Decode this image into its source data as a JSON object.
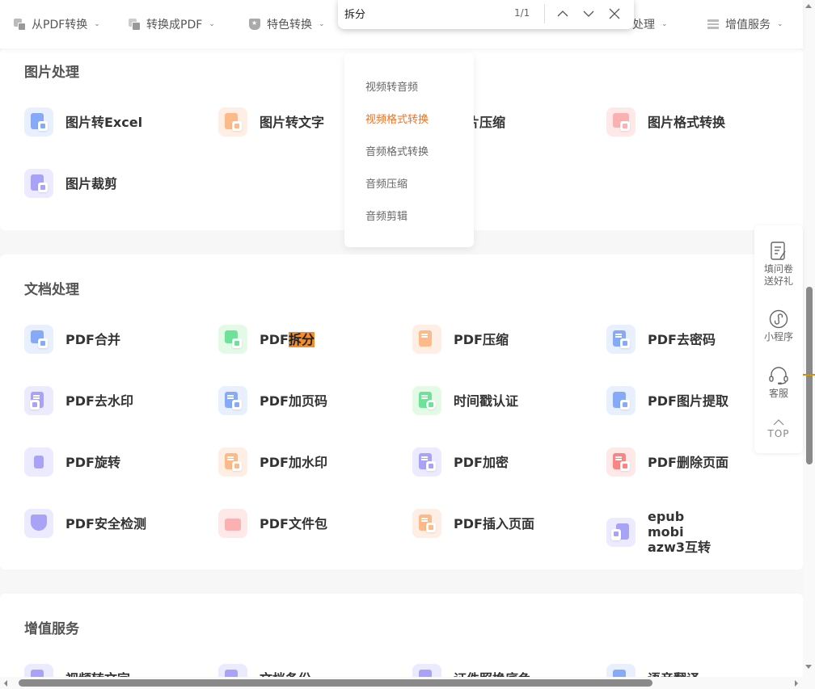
{
  "nav": {
    "items": [
      {
        "label": "从PDF转换",
        "icon": "pdf-from-icon"
      },
      {
        "label": "转换成PDF",
        "icon": "pdf-to-icon"
      },
      {
        "label": "特色转换",
        "icon": "shield-star-icon"
      },
      {
        "label": "处理",
        "icon": "media-icon"
      },
      {
        "label": "增值服务",
        "icon": "list-icon"
      }
    ],
    "accent": "#f37021"
  },
  "findbar": {
    "query": "拆分",
    "count": "1/1"
  },
  "dropdown": {
    "items": [
      {
        "label": "视频转音频",
        "active": false
      },
      {
        "label": "视频格式转换",
        "active": true
      },
      {
        "label": "音频格式转换",
        "active": false
      },
      {
        "label": "音频压缩",
        "active": false
      },
      {
        "label": "音频剪辑",
        "active": false
      }
    ]
  },
  "image_section": {
    "title": "图片处理",
    "tools": [
      {
        "label": "图片转Excel",
        "icon": "image-to-excel-icon"
      },
      {
        "label": "图片转文字",
        "icon": "image-to-text-icon"
      },
      {
        "label": "图片压缩",
        "icon": "image-compress-icon"
      },
      {
        "label": "图片格式转换",
        "icon": "image-format-icon"
      },
      {
        "label": "图片裁剪",
        "icon": "image-crop-icon"
      }
    ]
  },
  "doc_section": {
    "title": "文档处理",
    "tools": [
      {
        "label": "PDF合并",
        "icon": "merge-icon"
      },
      {
        "label_prefix": "PDF",
        "label_highlight": "拆分",
        "icon": "split-icon"
      },
      {
        "label": "PDF压缩",
        "icon": "compress-icon"
      },
      {
        "label": "PDF去密码",
        "icon": "unlock-icon"
      },
      {
        "label": "PDF去水印",
        "icon": "remove-watermark-icon"
      },
      {
        "label": "PDF加页码",
        "icon": "page-number-icon"
      },
      {
        "label": "时间戳认证",
        "icon": "timestamp-icon"
      },
      {
        "label": "PDF图片提取",
        "icon": "image-extract-icon"
      },
      {
        "label": "PDF旋转",
        "icon": "rotate-icon"
      },
      {
        "label": "PDF加水印",
        "icon": "add-watermark-icon"
      },
      {
        "label": "PDF加密",
        "icon": "lock-icon"
      },
      {
        "label": "PDF删除页面",
        "icon": "delete-page-icon"
      },
      {
        "label": "PDF安全检测",
        "icon": "security-check-icon"
      },
      {
        "label": "PDF文件包",
        "icon": "package-icon"
      },
      {
        "label": "PDF插入页面",
        "icon": "insert-page-icon"
      },
      {
        "label": "epub mobi azw3互转",
        "icon": "ebook-convert-icon"
      }
    ]
  },
  "vip_section": {
    "title": "增值服务",
    "tools": [
      {
        "label": "视频转文字",
        "icon": "video-to-text-icon"
      },
      {
        "label": "文档备份",
        "icon": "backup-icon"
      },
      {
        "label": "证件照换底色",
        "icon": "id-photo-icon"
      },
      {
        "label": "语音翻译",
        "icon": "voice-translate-icon"
      }
    ]
  },
  "sidepanel": {
    "survey": "填问卷送好礼",
    "survey_line1": "填问卷",
    "survey_line2": "送好礼",
    "miniprogram": "小程序",
    "service": "客服",
    "top": "TOP"
  }
}
